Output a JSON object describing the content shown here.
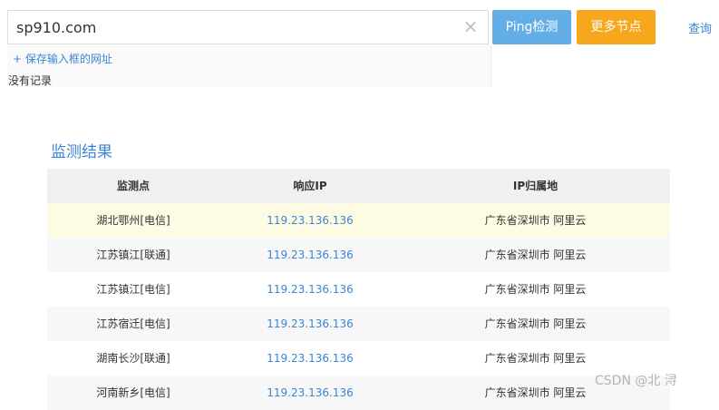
{
  "search": {
    "value": "sp910.com",
    "clear_icon": "×"
  },
  "dropdown": {
    "save_link": "+ 保存输入框的网址",
    "empty_text": "没有记录"
  },
  "buttons": {
    "ping": "Ping检测",
    "more_nodes": "更多节点"
  },
  "query_link": "查询",
  "results": {
    "title": "监测结果",
    "headers": [
      "监测点",
      "响应IP",
      "IP归属地"
    ],
    "rows": [
      {
        "node": "湖北鄂州[电信]",
        "ip": "119.23.136.136",
        "location": "广东省深圳市 阿里云"
      },
      {
        "node": "江苏镇江[联通]",
        "ip": "119.23.136.136",
        "location": "广东省深圳市 阿里云"
      },
      {
        "node": "江苏镇江[电信]",
        "ip": "119.23.136.136",
        "location": "广东省深圳市 阿里云"
      },
      {
        "node": "江苏宿迁[电信]",
        "ip": "119.23.136.136",
        "location": "广东省深圳市 阿里云"
      },
      {
        "node": "湖南长沙[联通]",
        "ip": "119.23.136.136",
        "location": "广东省深圳市 阿里云"
      },
      {
        "node": "河南新乡[电信]",
        "ip": "119.23.136.136",
        "location": "广东省深圳市 阿里云"
      }
    ]
  },
  "watermark": "CSDN @北 浔",
  "colors": {
    "accent": "#3a86d4",
    "ping_button": "#64aee8",
    "more_button": "#f7a71b",
    "highlight_row": "#fdfbe3"
  }
}
